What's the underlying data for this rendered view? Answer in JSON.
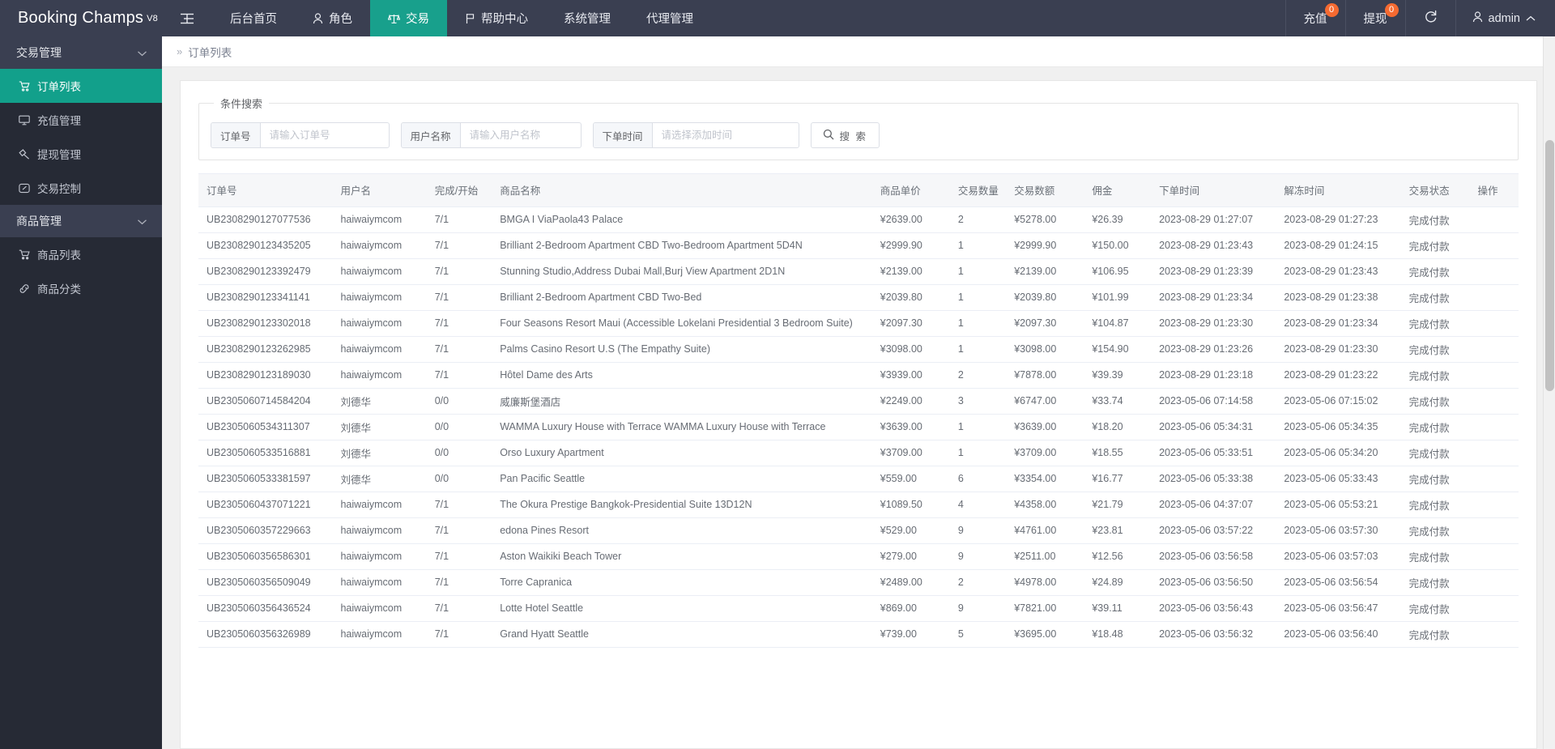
{
  "brand": {
    "name": "Booking Champs",
    "version": "V8"
  },
  "topnav": {
    "hamburger_icon": "menu-collapse-icon",
    "items": [
      {
        "label": "后台首页",
        "icon": "",
        "active": false
      },
      {
        "label": "角色",
        "icon": "user-icon",
        "active": false
      },
      {
        "label": "交易",
        "icon": "scale-icon",
        "active": true
      },
      {
        "label": "帮助中心",
        "icon": "flag-icon",
        "active": false
      },
      {
        "label": "系统管理",
        "icon": "",
        "active": false
      },
      {
        "label": "代理管理",
        "icon": "",
        "active": false
      }
    ]
  },
  "topright": {
    "recharge": {
      "label": "充值",
      "badge": "0"
    },
    "withdraw": {
      "label": "提现",
      "badge": "0"
    },
    "refresh_icon": "refresh-icon",
    "user": {
      "name": "admin",
      "icon": "user-icon",
      "chevron": "chevron-up-icon"
    }
  },
  "sidebar": {
    "groups": [
      {
        "label": "交易管理",
        "chevron": "chevron-down-icon",
        "items": [
          {
            "label": "订单列表",
            "icon": "cart-icon",
            "active": true
          },
          {
            "label": "充值管理",
            "icon": "monitor-icon",
            "active": false
          },
          {
            "label": "提现管理",
            "icon": "hammer-icon",
            "active": false
          },
          {
            "label": "交易控制",
            "icon": "gauge-icon",
            "active": false
          }
        ]
      },
      {
        "label": "商品管理",
        "chevron": "chevron-down-icon",
        "items": [
          {
            "label": "商品列表",
            "icon": "shopping-cart-icon",
            "active": false
          },
          {
            "label": "商品分类",
            "icon": "link-icon",
            "active": false
          }
        ]
      }
    ]
  },
  "breadcrumb": {
    "arrows": "»",
    "current": "订单列表"
  },
  "search": {
    "legend": "条件搜索",
    "fields": [
      {
        "label": "订单号",
        "placeholder": "请输入订单号",
        "value": ""
      },
      {
        "label": "用户名称",
        "placeholder": "请输入用户名称",
        "value": ""
      },
      {
        "label": "下单时间",
        "placeholder": "请选择添加时间",
        "value": ""
      }
    ],
    "button": {
      "label": "搜 索",
      "icon": "search-icon"
    }
  },
  "table": {
    "columns": [
      "订单号",
      "用户名",
      "完成/开始",
      "商品名称",
      "商品单价",
      "交易数量",
      "交易数额",
      "佣金",
      "下单时间",
      "解冻时间",
      "交易状态",
      "操作"
    ],
    "rows": [
      {
        "order_no": "UB2308290127077536",
        "user": "haiwaiymcom",
        "progress": "7/1",
        "product": "BMGA I ViaPaola43 Palace",
        "price": "¥2639.00",
        "qty": "2",
        "amount": "¥5278.00",
        "commission": "¥26.39",
        "order_time": "2023-08-29 01:27:07",
        "unfreeze_time": "2023-08-29 01:27:23",
        "status": "完成付款",
        "action": ""
      },
      {
        "order_no": "UB2308290123435205",
        "user": "haiwaiymcom",
        "progress": "7/1",
        "product": "Brilliant 2-Bedroom Apartment CBD Two-Bedroom Apartment 5D4N",
        "price": "¥2999.90",
        "qty": "1",
        "amount": "¥2999.90",
        "commission": "¥150.00",
        "order_time": "2023-08-29 01:23:43",
        "unfreeze_time": "2023-08-29 01:24:15",
        "status": "完成付款",
        "action": ""
      },
      {
        "order_no": "UB2308290123392479",
        "user": "haiwaiymcom",
        "progress": "7/1",
        "product": "Stunning Studio,Address Dubai Mall,Burj View Apartment 2D1N",
        "price": "¥2139.00",
        "qty": "1",
        "amount": "¥2139.00",
        "commission": "¥106.95",
        "order_time": "2023-08-29 01:23:39",
        "unfreeze_time": "2023-08-29 01:23:43",
        "status": "完成付款",
        "action": ""
      },
      {
        "order_no": "UB2308290123341141",
        "user": "haiwaiymcom",
        "progress": "7/1",
        "product": "Brilliant 2-Bedroom Apartment CBD Two-Bed",
        "price": "¥2039.80",
        "qty": "1",
        "amount": "¥2039.80",
        "commission": "¥101.99",
        "order_time": "2023-08-29 01:23:34",
        "unfreeze_time": "2023-08-29 01:23:38",
        "status": "完成付款",
        "action": ""
      },
      {
        "order_no": "UB2308290123302018",
        "user": "haiwaiymcom",
        "progress": "7/1",
        "product": "Four Seasons Resort Maui (Accessible Lokelani Presidential 3 Bedroom Suite)",
        "price": "¥2097.30",
        "qty": "1",
        "amount": "¥2097.30",
        "commission": "¥104.87",
        "order_time": "2023-08-29 01:23:30",
        "unfreeze_time": "2023-08-29 01:23:34",
        "status": "完成付款",
        "action": ""
      },
      {
        "order_no": "UB2308290123262985",
        "user": "haiwaiymcom",
        "progress": "7/1",
        "product": "Palms Casino Resort U.S (The Empathy Suite)",
        "price": "¥3098.00",
        "qty": "1",
        "amount": "¥3098.00",
        "commission": "¥154.90",
        "order_time": "2023-08-29 01:23:26",
        "unfreeze_time": "2023-08-29 01:23:30",
        "status": "完成付款",
        "action": ""
      },
      {
        "order_no": "UB2308290123189030",
        "user": "haiwaiymcom",
        "progress": "7/1",
        "product": "Hôtel Dame des Arts",
        "price": "¥3939.00",
        "qty": "2",
        "amount": "¥7878.00",
        "commission": "¥39.39",
        "order_time": "2023-08-29 01:23:18",
        "unfreeze_time": "2023-08-29 01:23:22",
        "status": "完成付款",
        "action": ""
      },
      {
        "order_no": "UB2305060714584204",
        "user": "刘德华",
        "progress": "0/0",
        "product": "威廉斯堡酒店",
        "price": "¥2249.00",
        "qty": "3",
        "amount": "¥6747.00",
        "commission": "¥33.74",
        "order_time": "2023-05-06 07:14:58",
        "unfreeze_time": "2023-05-06 07:15:02",
        "status": "完成付款",
        "action": ""
      },
      {
        "order_no": "UB2305060534311307",
        "user": "刘德华",
        "progress": "0/0",
        "product": "WAMMA Luxury House with Terrace WAMMA Luxury House with Terrace",
        "price": "¥3639.00",
        "qty": "1",
        "amount": "¥3639.00",
        "commission": "¥18.20",
        "order_time": "2023-05-06 05:34:31",
        "unfreeze_time": "2023-05-06 05:34:35",
        "status": "完成付款",
        "action": ""
      },
      {
        "order_no": "UB2305060533516881",
        "user": "刘德华",
        "progress": "0/0",
        "product": "Orso Luxury Apartment",
        "price": "¥3709.00",
        "qty": "1",
        "amount": "¥3709.00",
        "commission": "¥18.55",
        "order_time": "2023-05-06 05:33:51",
        "unfreeze_time": "2023-05-06 05:34:20",
        "status": "完成付款",
        "action": ""
      },
      {
        "order_no": "UB2305060533381597",
        "user": "刘德华",
        "progress": "0/0",
        "product": "Pan Pacific Seattle",
        "price": "¥559.00",
        "qty": "6",
        "amount": "¥3354.00",
        "commission": "¥16.77",
        "order_time": "2023-05-06 05:33:38",
        "unfreeze_time": "2023-05-06 05:33:43",
        "status": "完成付款",
        "action": ""
      },
      {
        "order_no": "UB2305060437071221",
        "user": "haiwaiymcom",
        "progress": "7/1",
        "product": "The Okura Prestige Bangkok-Presidential Suite 13D12N",
        "price": "¥1089.50",
        "qty": "4",
        "amount": "¥4358.00",
        "commission": "¥21.79",
        "order_time": "2023-05-06 04:37:07",
        "unfreeze_time": "2023-05-06 05:53:21",
        "status": "完成付款",
        "action": ""
      },
      {
        "order_no": "UB2305060357229663",
        "user": "haiwaiymcom",
        "progress": "7/1",
        "product": "edona Pines Resort",
        "price": "¥529.00",
        "qty": "9",
        "amount": "¥4761.00",
        "commission": "¥23.81",
        "order_time": "2023-05-06 03:57:22",
        "unfreeze_time": "2023-05-06 03:57:30",
        "status": "完成付款",
        "action": ""
      },
      {
        "order_no": "UB2305060356586301",
        "user": "haiwaiymcom",
        "progress": "7/1",
        "product": "Aston Waikiki Beach Tower",
        "price": "¥279.00",
        "qty": "9",
        "amount": "¥2511.00",
        "commission": "¥12.56",
        "order_time": "2023-05-06 03:56:58",
        "unfreeze_time": "2023-05-06 03:57:03",
        "status": "完成付款",
        "action": ""
      },
      {
        "order_no": "UB2305060356509049",
        "user": "haiwaiymcom",
        "progress": "7/1",
        "product": "Torre Capranica",
        "price": "¥2489.00",
        "qty": "2",
        "amount": "¥4978.00",
        "commission": "¥24.89",
        "order_time": "2023-05-06 03:56:50",
        "unfreeze_time": "2023-05-06 03:56:54",
        "status": "完成付款",
        "action": ""
      },
      {
        "order_no": "UB2305060356436524",
        "user": "haiwaiymcom",
        "progress": "7/1",
        "product": "Lotte Hotel Seattle",
        "price": "¥869.00",
        "qty": "9",
        "amount": "¥7821.00",
        "commission": "¥39.11",
        "order_time": "2023-05-06 03:56:43",
        "unfreeze_time": "2023-05-06 03:56:47",
        "status": "完成付款",
        "action": ""
      },
      {
        "order_no": "UB2305060356326989",
        "user": "haiwaiymcom",
        "progress": "7/1",
        "product": "Grand Hyatt Seattle",
        "price": "¥739.00",
        "qty": "5",
        "amount": "¥3695.00",
        "commission": "¥18.48",
        "order_time": "2023-05-06 03:56:32",
        "unfreeze_time": "2023-05-06 03:56:40",
        "status": "完成付款",
        "action": ""
      }
    ]
  },
  "colors": {
    "topbar_bg": "#3a3f51",
    "sidebar_bg": "#262a35",
    "accent_teal": "#12a08b",
    "badge_orange": "#f56a31"
  }
}
